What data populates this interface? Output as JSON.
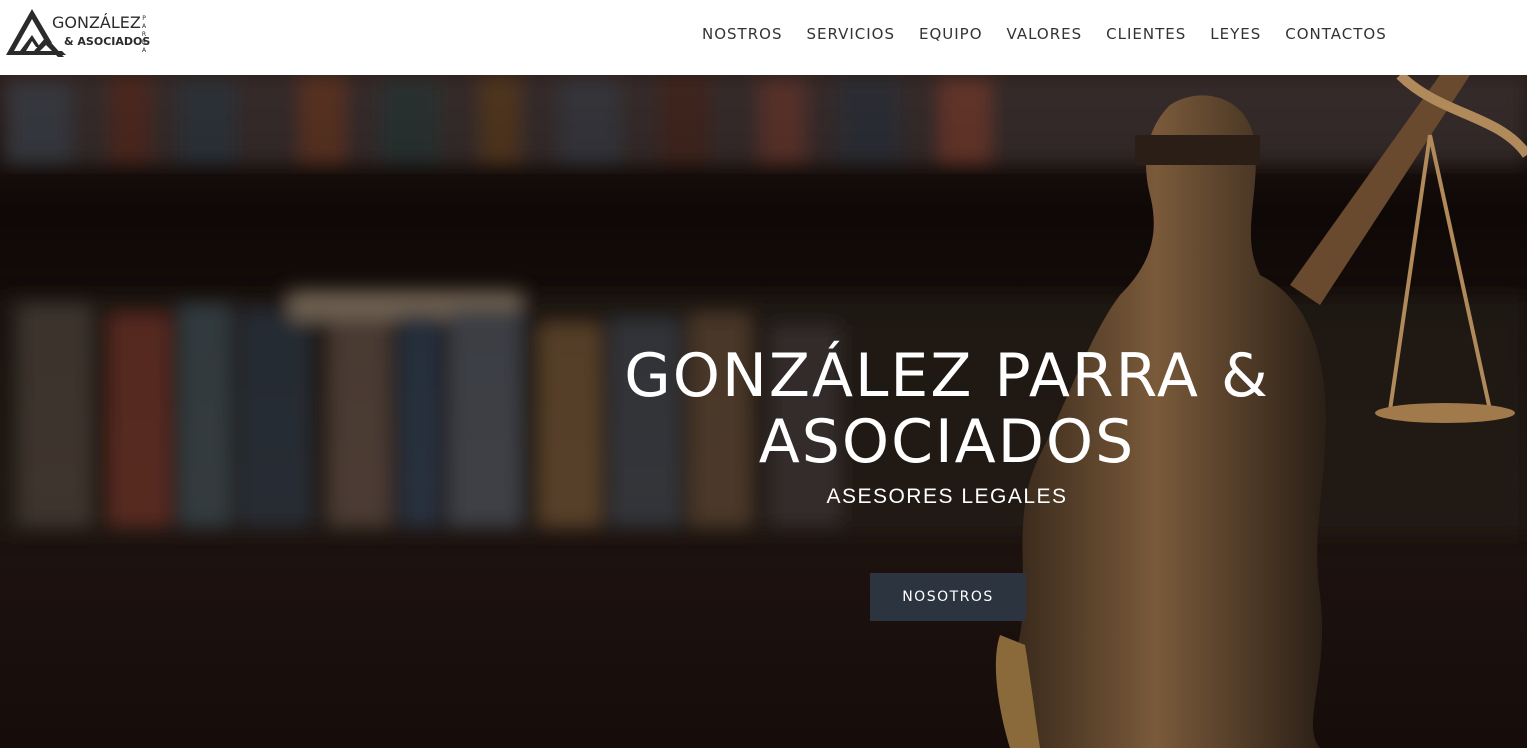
{
  "header": {
    "logo": {
      "name": "GONZÁLEZ",
      "sub": "& ASOCIADOS",
      "vertical": "PARRA"
    },
    "nav": [
      {
        "label": "NOSTROS"
      },
      {
        "label": "SERVICIOS"
      },
      {
        "label": "EQUIPO"
      },
      {
        "label": "VALORES"
      },
      {
        "label": "CLIENTES"
      },
      {
        "label": "LEYES"
      },
      {
        "label": "CONTACTOS"
      }
    ]
  },
  "hero": {
    "title": "GONZÁLEZ PARRA & ASOCIADOS",
    "subtitle": "ASESORES LEGALES",
    "button_label": "NOSOTROS",
    "background_icon": "justice-statue-photo"
  },
  "colors": {
    "header_bg": "#ffffff",
    "nav_text": "#333333",
    "hero_text": "#ffffff",
    "button_bg": "#2c3440"
  }
}
